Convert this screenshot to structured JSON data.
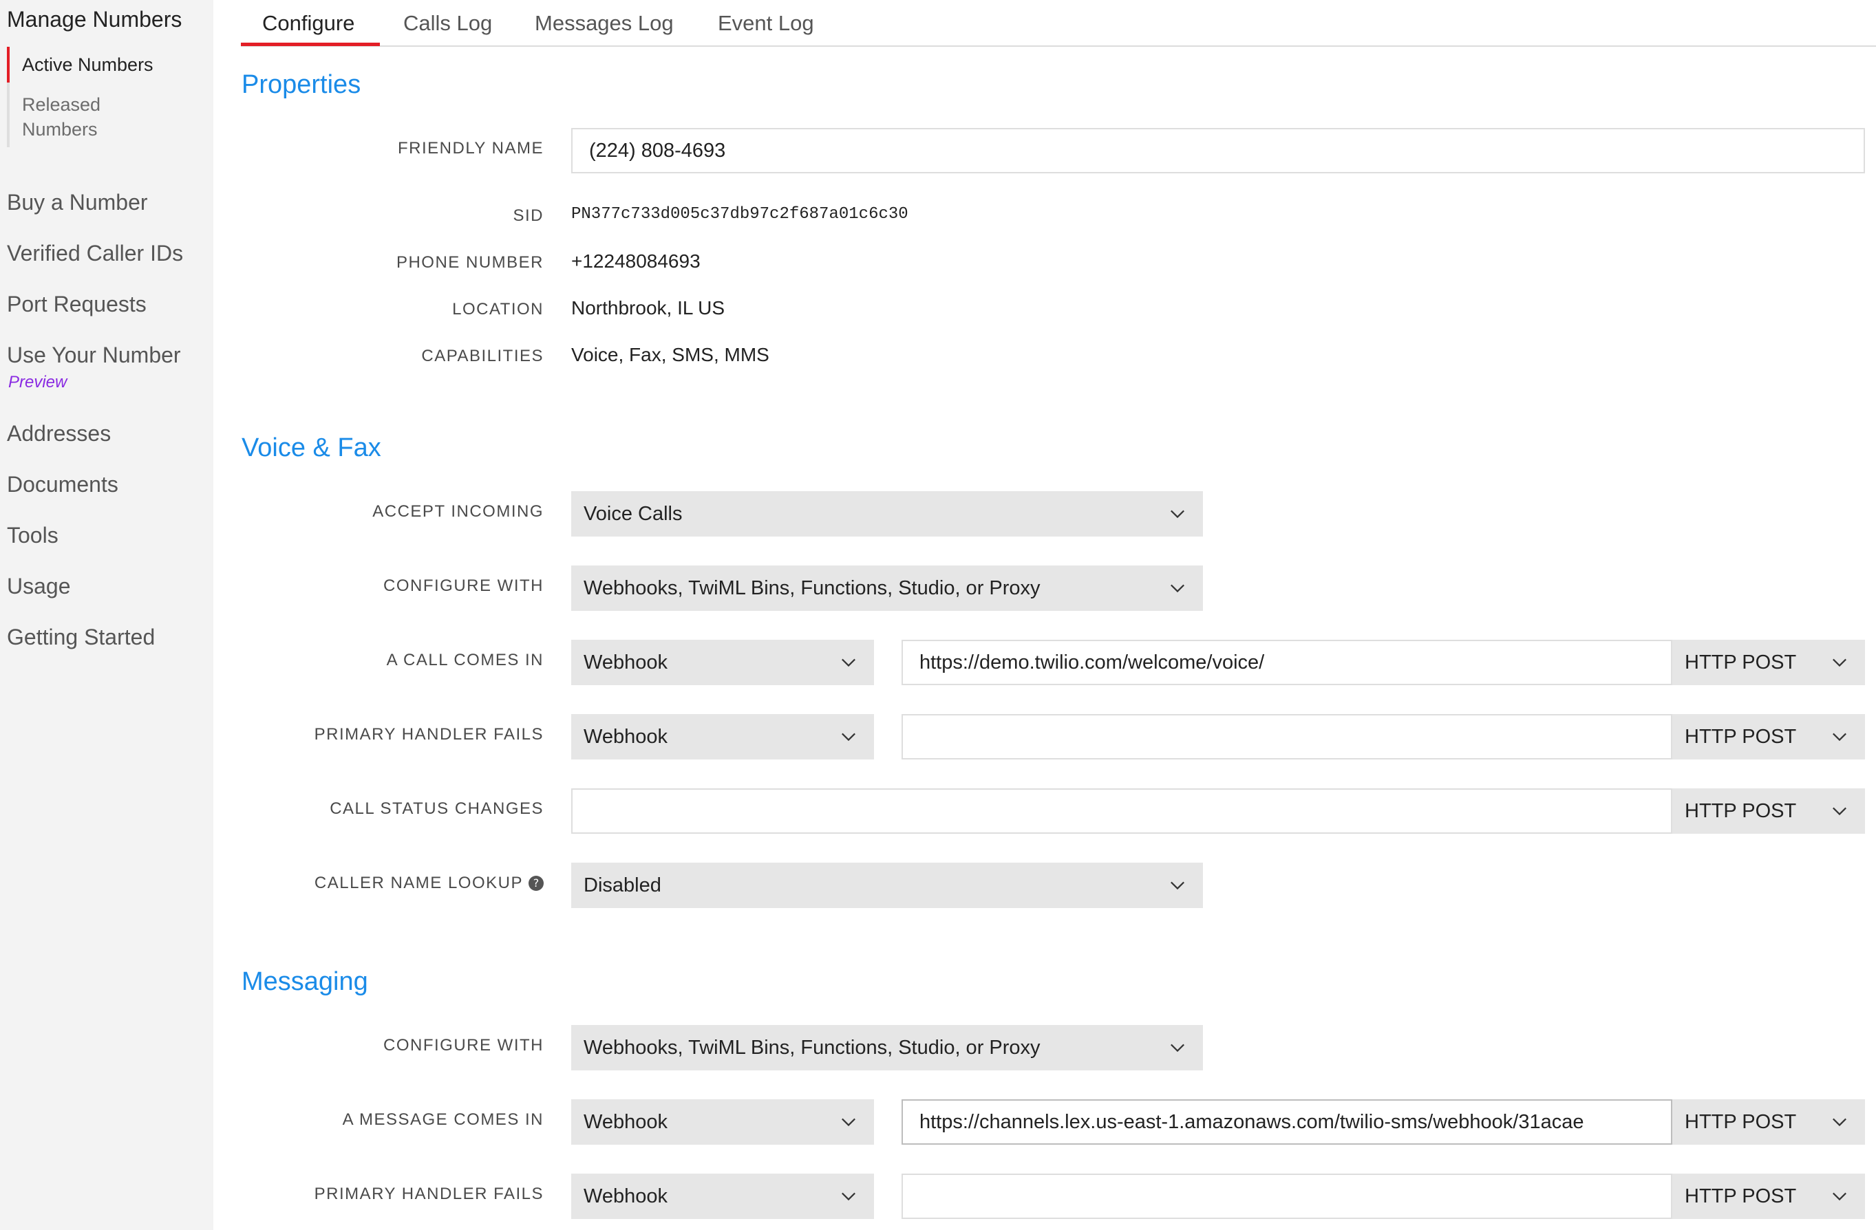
{
  "sidebar": {
    "title": "Manage Numbers",
    "sub_items": [
      "Active Numbers",
      "Released Numbers"
    ],
    "items": [
      "Buy a Number",
      "Verified Caller IDs",
      "Port Requests",
      "Use Your Number",
      "Addresses",
      "Documents",
      "Tools",
      "Usage",
      "Getting Started"
    ],
    "preview_badge": "Preview",
    "accent_color": "#e31e26"
  },
  "tabs": [
    "Configure",
    "Calls Log",
    "Messages Log",
    "Event Log"
  ],
  "properties": {
    "title": "Properties",
    "friendly_name_label": "FRIENDLY NAME",
    "friendly_name": "(224) 808-4693",
    "sid_label": "SID",
    "sid": "PN377c733d005c37db97c2f687a01c6c30",
    "phone_label": "PHONE NUMBER",
    "phone": "+12248084693",
    "location_label": "LOCATION",
    "location": "Northbrook, IL US",
    "capabilities_label": "CAPABILITIES",
    "capabilities": "Voice, Fax, SMS, MMS"
  },
  "voice": {
    "title": "Voice & Fax",
    "accept_label": "ACCEPT INCOMING",
    "accept_value": "Voice Calls",
    "configure_label": "CONFIGURE WITH",
    "configure_value": "Webhooks, TwiML Bins, Functions, Studio, or Proxy",
    "call_in_label": "A CALL COMES IN",
    "call_in_type": "Webhook",
    "call_in_url": "https://demo.twilio.com/welcome/voice/",
    "call_in_method": "HTTP POST",
    "primary_fail_label": "PRIMARY HANDLER FAILS",
    "primary_fail_type": "Webhook",
    "primary_fail_url": "",
    "primary_fail_method": "HTTP POST",
    "status_label": "CALL STATUS CHANGES",
    "status_url": "",
    "status_method": "HTTP POST",
    "lookup_label": "CALLER NAME LOOKUP",
    "lookup_value": "Disabled"
  },
  "messaging": {
    "title": "Messaging",
    "configure_label": "CONFIGURE WITH",
    "configure_value": "Webhooks, TwiML Bins, Functions, Studio, or Proxy",
    "message_in_label": "A MESSAGE COMES IN",
    "message_in_type": "Webhook",
    "message_in_url": "https://channels.lex.us-east-1.amazonaws.com/twilio-sms/webhook/31acae",
    "message_in_method": "HTTP POST",
    "primary_fail_label": "PRIMARY HANDLER FAILS",
    "primary_fail_type": "Webhook",
    "primary_fail_url": "",
    "primary_fail_method": "HTTP POST"
  },
  "colors": {
    "link_blue": "#1a8be8",
    "select_bg": "#e6e6e6",
    "sidebar_bg": "#f3f3f3"
  }
}
